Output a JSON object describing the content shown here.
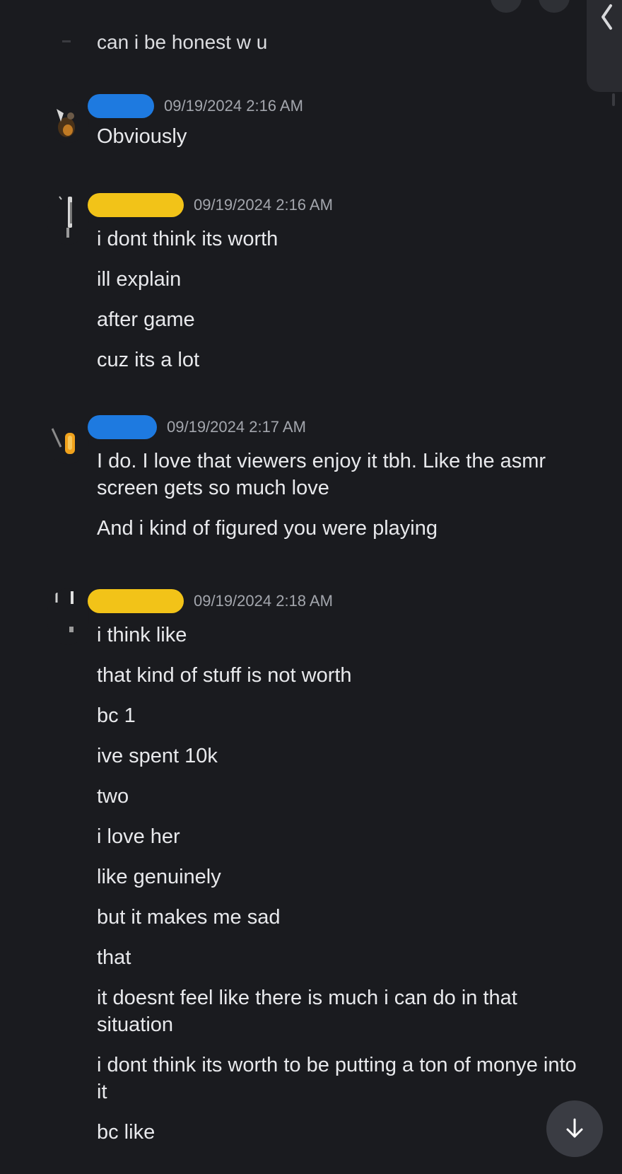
{
  "partial_message": "can i be honest w u",
  "groups": [
    {
      "author_color": "#1e7ae0",
      "timestamp": "09/19/2024 2:16 AM",
      "lines": [
        "Obviously"
      ]
    },
    {
      "author_color": "#f2c318",
      "timestamp": "09/19/2024 2:16 AM",
      "lines": [
        "i dont think its worth",
        "ill explain",
        "after game",
        "cuz its a lot"
      ]
    },
    {
      "author_color": "#1e7ae0",
      "timestamp": "09/19/2024 2:17 AM",
      "lines": [
        "I do. I love that viewers enjoy it tbh. Like the asmr screen gets so much love",
        "And i kind of figured you were playing"
      ]
    },
    {
      "author_color": "#f2c318",
      "timestamp": "09/19/2024 2:18 AM",
      "lines": [
        "i think like",
        "that kind of stuff is not worth",
        "bc 1",
        "ive spent 10k",
        "two",
        "i love her",
        "like genuinely",
        "but it makes me sad",
        "that",
        "it doesnt feel like there is much i can do in that situation",
        "i dont think its worth to be putting a ton of monye into it",
        "bc like"
      ]
    }
  ],
  "icons": {
    "scroll_down": "arrow-down-icon",
    "panel_toggle": "chevron-left-icon"
  }
}
